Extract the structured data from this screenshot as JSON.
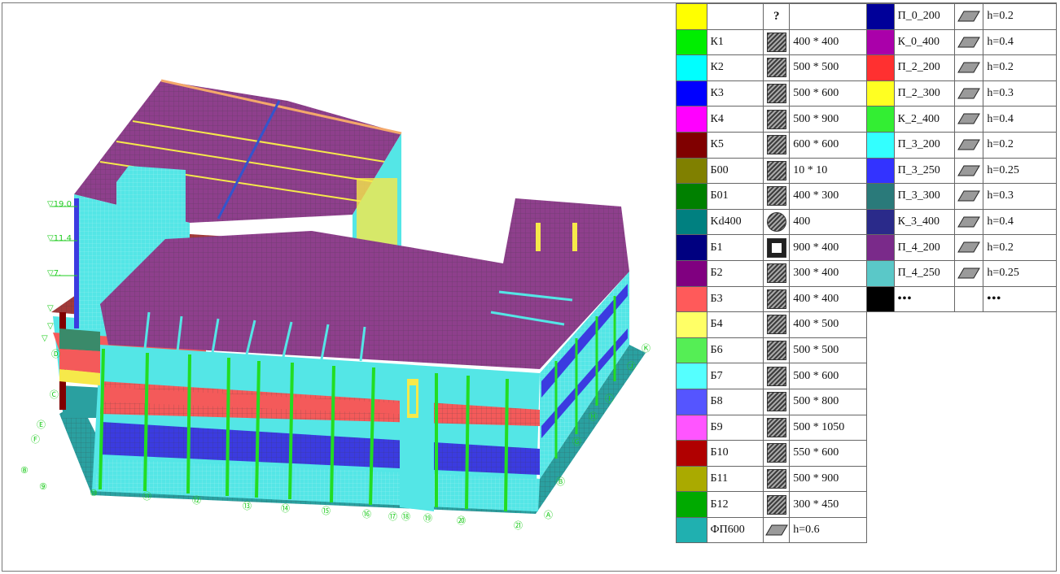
{
  "window": {
    "title": ""
  },
  "model": {
    "levels": [
      "▽19.0",
      "▽11.4",
      "▽7.",
      "▽",
      "▽",
      "▽"
    ],
    "axes": [
      "⑧",
      "⑨",
      "⑩",
      "⑪",
      "⑫",
      "⑬",
      "⑭",
      "⑮",
      "⑯",
      "⑰",
      "⑱",
      "⑲",
      "⑳",
      "㉑",
      "Ⓐ",
      "Ⓑ",
      "Ⓒ",
      "Ⓓ",
      "Ⓔ",
      "Ⓕ",
      "Ⓖ",
      "Ⓗ",
      "Ⓘ",
      "Ⓙ",
      "Ⓚ"
    ],
    "colors": {
      "slab": "#8e3f8c",
      "wall": "#54e6e6",
      "beam_red": "#f45a5a",
      "beam_blue": "#3b3be0",
      "column": "#22dd22",
      "base": "#2aa0a0",
      "label": "#22cc22"
    }
  },
  "legend_left": {
    "rows": [
      {
        "color": "#ffff00",
        "name": "",
        "icon": "question",
        "icon_text": "?",
        "section": ""
      },
      {
        "color": "#00ee00",
        "name": "К1",
        "icon": "hatch",
        "section": "400 * 400"
      },
      {
        "color": "#00ffff",
        "name": "К2",
        "icon": "hatch",
        "section": "500 * 500"
      },
      {
        "color": "#0000ff",
        "name": "К3",
        "icon": "hatch",
        "section": "500 * 600"
      },
      {
        "color": "#ff00ff",
        "name": "К4",
        "icon": "hatch",
        "section": "500 * 900"
      },
      {
        "color": "#800000",
        "name": "К5",
        "icon": "hatch",
        "section": "600 * 600"
      },
      {
        "color": "#808000",
        "name": "Б00",
        "icon": "hatch",
        "section": "10 * 10"
      },
      {
        "color": "#008000",
        "name": "Б01",
        "icon": "hatch",
        "section": "400 * 300"
      },
      {
        "color": "#008080",
        "name": "Kd400",
        "icon": "circle",
        "section": "400"
      },
      {
        "color": "#000080",
        "name": "Б1",
        "icon": "box",
        "section": "900  * 400"
      },
      {
        "color": "#800080",
        "name": "Б2",
        "icon": "hatch",
        "section": "300 * 400"
      },
      {
        "color": "#ff5a5a",
        "name": "Б3",
        "icon": "hatch",
        "section": "400 * 400"
      },
      {
        "color": "#ffff66",
        "name": "Б4",
        "icon": "hatch",
        "section": "400 * 500"
      },
      {
        "color": "#55ee55",
        "name": "Б6",
        "icon": "hatch",
        "section": "500 * 500"
      },
      {
        "color": "#55ffff",
        "name": "Б7",
        "icon": "hatch",
        "section": "500 * 600"
      },
      {
        "color": "#5555ff",
        "name": "Б8",
        "icon": "hatch",
        "section": "500 * 800"
      },
      {
        "color": "#ff55ff",
        "name": "Б9",
        "icon": "hatch",
        "section": "500 * 1050"
      },
      {
        "color": "#b00000",
        "name": "Б10",
        "icon": "hatch",
        "section": "550 * 600"
      },
      {
        "color": "#aaaa00",
        "name": "Б11",
        "icon": "hatch",
        "section": "500 * 900"
      },
      {
        "color": "#00aa00",
        "name": "Б12",
        "icon": "hatch",
        "section": "300 * 450"
      },
      {
        "color": "#20b0b0",
        "name": "ФП600",
        "icon": "plate",
        "section": "h=0.6"
      }
    ]
  },
  "legend_right": {
    "rows": [
      {
        "color": "#000099",
        "name": "П_0_200",
        "icon": "plate",
        "section": "h=0.2"
      },
      {
        "color": "#aa00aa",
        "name": "К_0_400",
        "icon": "plate",
        "section": "h=0.4"
      },
      {
        "color": "#ff3030",
        "name": "П_2_200",
        "icon": "plate",
        "section": "h=0.2"
      },
      {
        "color": "#ffff22",
        "name": "П_2_300",
        "icon": "plate",
        "section": "h=0.3"
      },
      {
        "color": "#33ee33",
        "name": "К_2_400",
        "icon": "plate",
        "section": "h=0.4"
      },
      {
        "color": "#33ffff",
        "name": "П_3_200",
        "icon": "plate",
        "section": "h=0.2"
      },
      {
        "color": "#3333ff",
        "name": "П_3_250",
        "icon": "plate",
        "section": "h=0.25"
      },
      {
        "color": "#2a7a7a",
        "name": "П_3_300",
        "icon": "plate",
        "section": "h=0.3"
      },
      {
        "color": "#2a2a8a",
        "name": "К_3_400",
        "icon": "plate",
        "section": "h=0.4"
      },
      {
        "color": "#7a2a8a",
        "name": "П_4_200",
        "icon": "plate",
        "section": "h=0.2"
      },
      {
        "color": "#5ac8c8",
        "name": "П_4_250",
        "icon": "plate",
        "section": "h=0.25"
      },
      {
        "color": "#000000",
        "name": "•••",
        "icon": "none",
        "section": "•••"
      }
    ]
  }
}
